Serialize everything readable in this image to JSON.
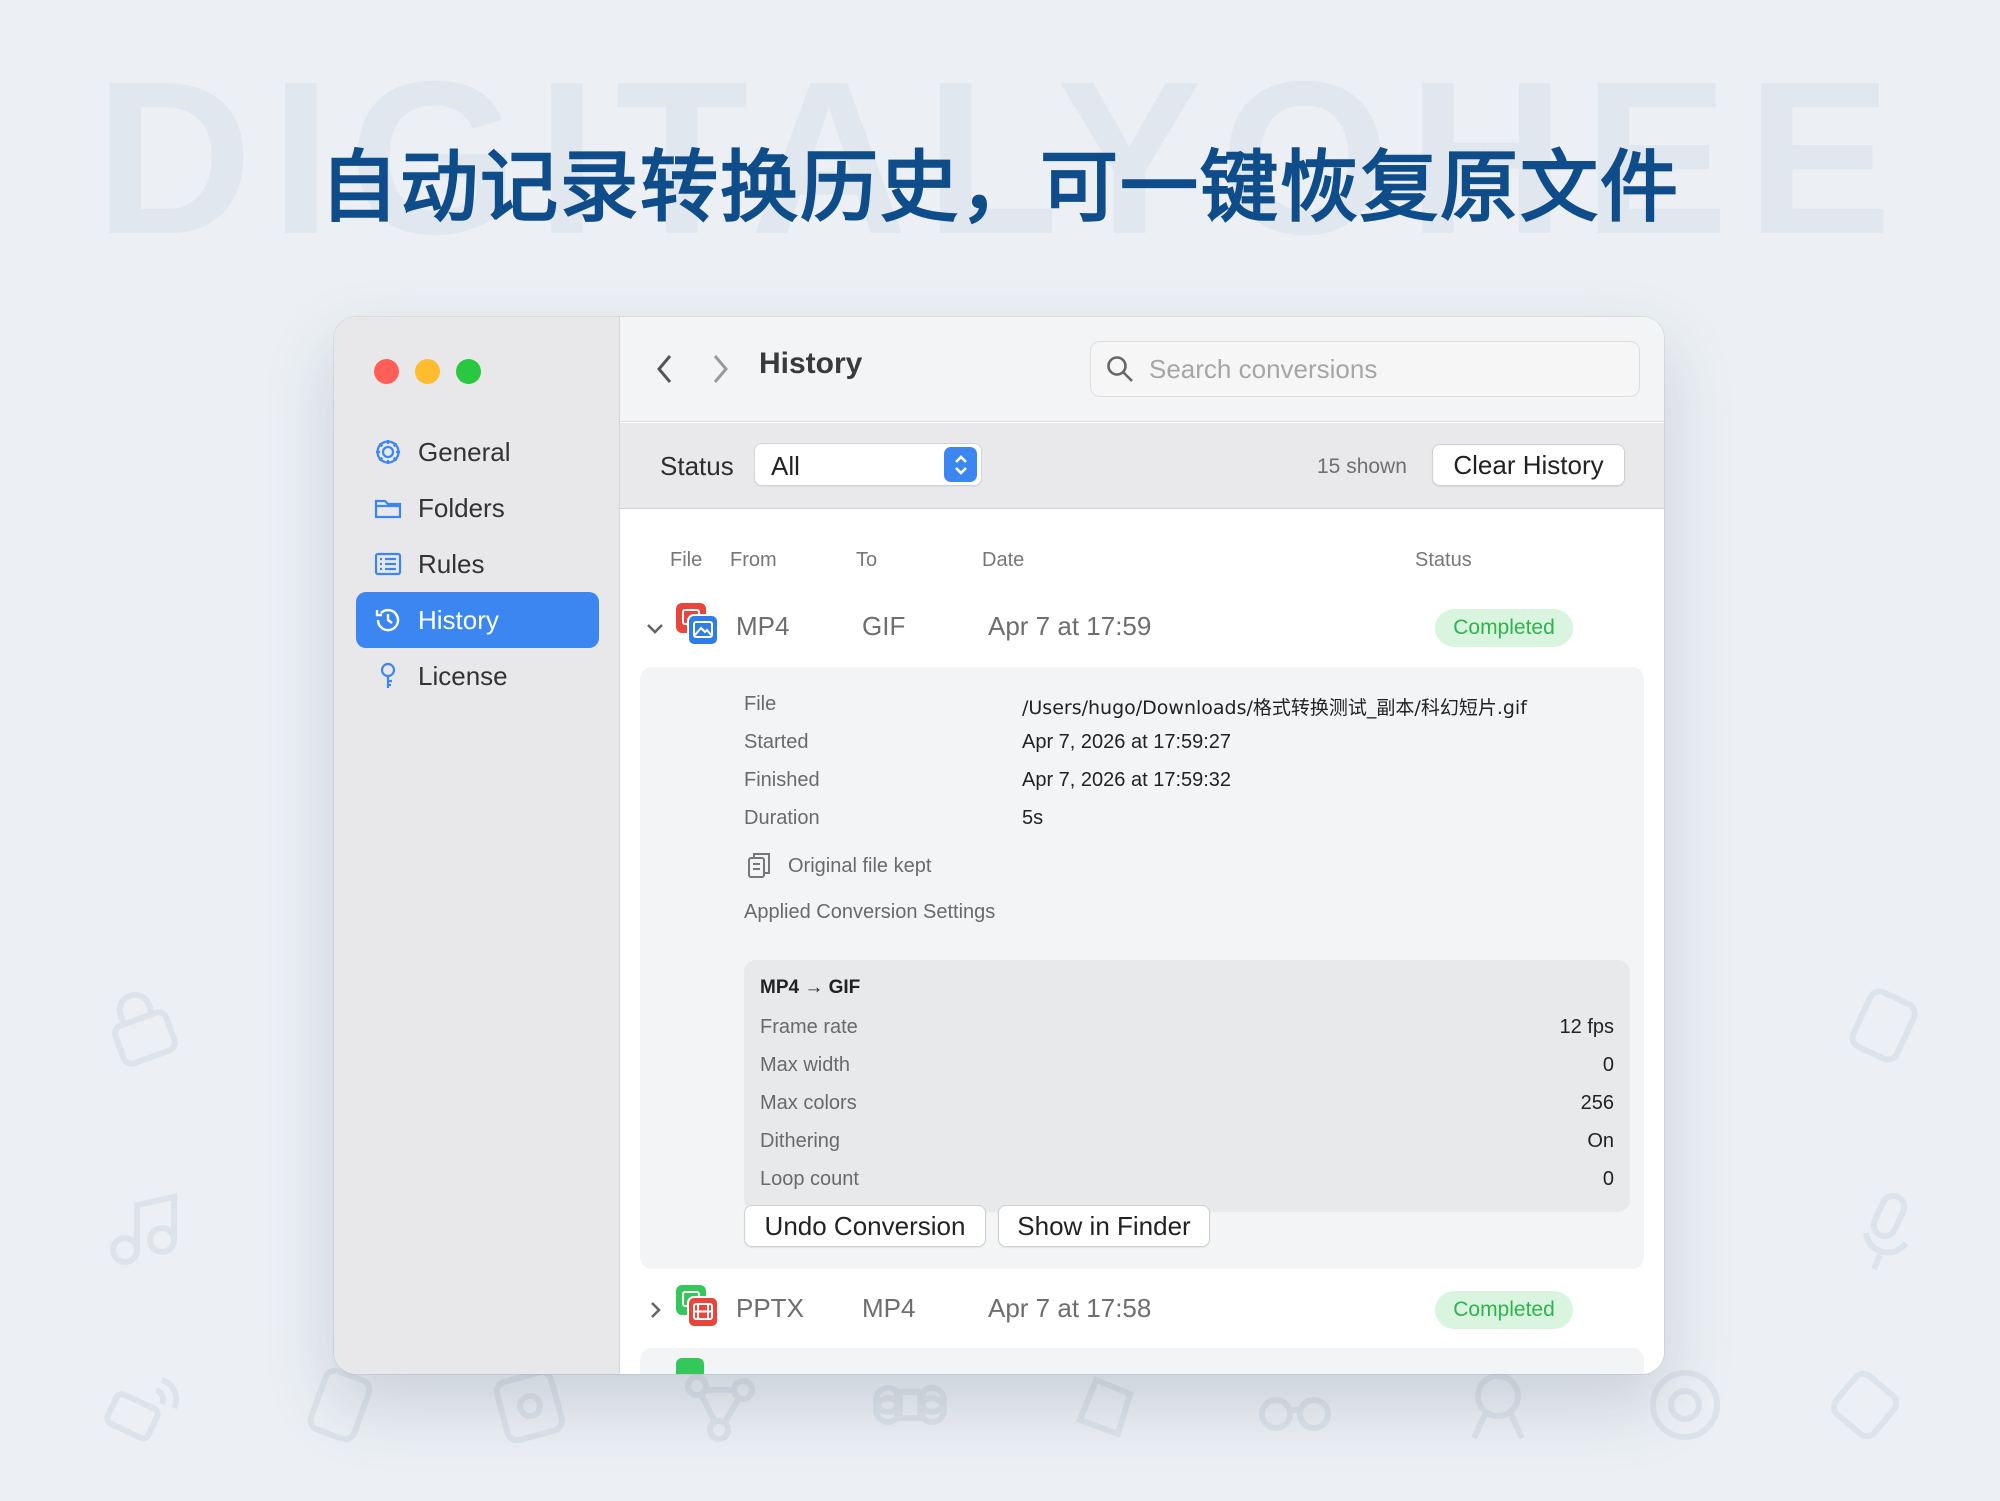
{
  "watermark": "DIGITALYOHEE",
  "headline": "自动记录转换历史，可一键恢复原文件",
  "sidebar": {
    "items": [
      {
        "label": "General",
        "icon": "gear-icon"
      },
      {
        "label": "Folders",
        "icon": "folder-icon"
      },
      {
        "label": "Rules",
        "icon": "list-icon"
      },
      {
        "label": "History",
        "icon": "history-icon"
      },
      {
        "label": "License",
        "icon": "key-icon"
      }
    ],
    "active": "History"
  },
  "toolbar": {
    "title": "History",
    "search_placeholder": "Search conversions"
  },
  "filter": {
    "status_label": "Status",
    "status_value": "All",
    "shown_count": "15 shown",
    "clear_label": "Clear History"
  },
  "columns": {
    "file": "File",
    "from": "From",
    "to": "To",
    "date": "Date",
    "status": "Status"
  },
  "rows": [
    {
      "from": "MP4",
      "to": "GIF",
      "date": "Apr 7 at 17:59",
      "status": "Completed",
      "expanded": true
    },
    {
      "from": "PPTX",
      "to": "MP4",
      "date": "Apr 7 at 17:58",
      "status": "Completed",
      "expanded": false
    }
  ],
  "detail": {
    "file_label": "File",
    "file_value": "/Users/hugo/Downloads/格式转换测试_副本/科幻短片.gif",
    "started_label": "Started",
    "started_value": "Apr 7, 2026 at 17:59:27",
    "finished_label": "Finished",
    "finished_value": "Apr 7, 2026 at 17:59:32",
    "duration_label": "Duration",
    "duration_value": "5s",
    "original_kept": "Original file kept",
    "applied_label": "Applied Conversion Settings",
    "settings": {
      "title": "MP4 → GIF",
      "items": [
        {
          "label": "Frame rate",
          "value": "12 fps"
        },
        {
          "label": "Max width",
          "value": "0"
        },
        {
          "label": "Max colors",
          "value": "256"
        },
        {
          "label": "Dithering",
          "value": "On"
        },
        {
          "label": "Loop count",
          "value": "0"
        }
      ]
    },
    "undo_label": "Undo Conversion",
    "finder_label": "Show in Finder"
  },
  "colors": {
    "accent": "#3b86f0",
    "headline": "#0f4c8a",
    "badge_bg": "#d9f5df",
    "badge_text": "#2fb34f",
    "close": "#ff5f57",
    "minimize": "#febc2e",
    "zoom": "#28c840"
  }
}
